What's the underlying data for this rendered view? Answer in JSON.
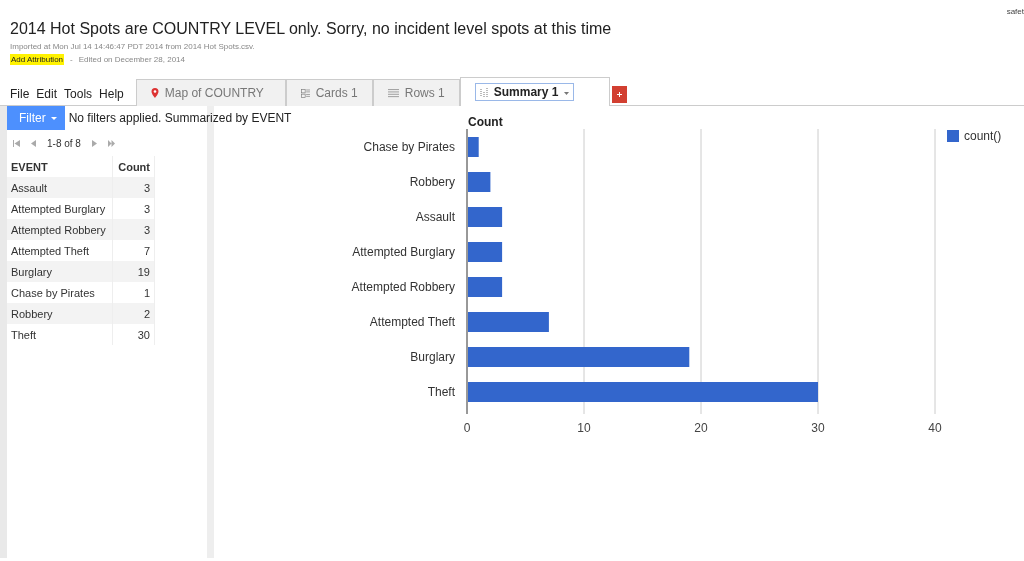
{
  "corner_text": "safet",
  "title": "2014 Hot Spots are COUNTRY LEVEL only. Sorry, no incident level spots at this time",
  "imported": "Imported at Mon Jul 14 14:46:47 PDT 2014 from 2014 Hot Spots.csv.",
  "attribution": "Add Attribution",
  "separator": "-",
  "edited": "Edited on December 28, 2014",
  "menu": [
    "File",
    "Edit",
    "Tools",
    "Help"
  ],
  "tabs": [
    {
      "label": "Map of COUNTRY",
      "kind": "map",
      "selected": false
    },
    {
      "label": "Cards 1",
      "kind": "cards",
      "selected": false
    },
    {
      "label": "Rows 1",
      "kind": "rows",
      "selected": false
    },
    {
      "label": "Summary 1",
      "kind": "summary",
      "selected": true
    }
  ],
  "filter": {
    "button": "Filter",
    "status": "No filters applied. Summarized by EVENT"
  },
  "pager": "1-8 of 8",
  "table": {
    "columns": [
      "EVENT",
      "Count"
    ],
    "rows": [
      [
        "Assault",
        "3"
      ],
      [
        "Attempted Burglary",
        "3"
      ],
      [
        "Attempted Robbery",
        "3"
      ],
      [
        "Attempted Theft",
        "7"
      ],
      [
        "Burglary",
        "19"
      ],
      [
        "Chase by Pirates",
        "1"
      ],
      [
        "Robbery",
        "2"
      ],
      [
        "Theft",
        "30"
      ]
    ]
  },
  "chart": {
    "chart_data": {
      "type": "bar",
      "orientation": "horizontal",
      "title": "Count",
      "categories": [
        "Chase by Pirates",
        "Robbery",
        "Assault",
        "Attempted Burglary",
        "Attempted Robbery",
        "Attempted Theft",
        "Burglary",
        "Theft"
      ],
      "series": [
        {
          "name": "count()",
          "color": "#3366cc",
          "values": [
            1,
            2,
            3,
            3,
            3,
            7,
            19,
            30
          ]
        }
      ],
      "xlim": [
        0,
        40
      ],
      "xticks": [
        0,
        10,
        20,
        30,
        40
      ],
      "grid": true
    }
  }
}
